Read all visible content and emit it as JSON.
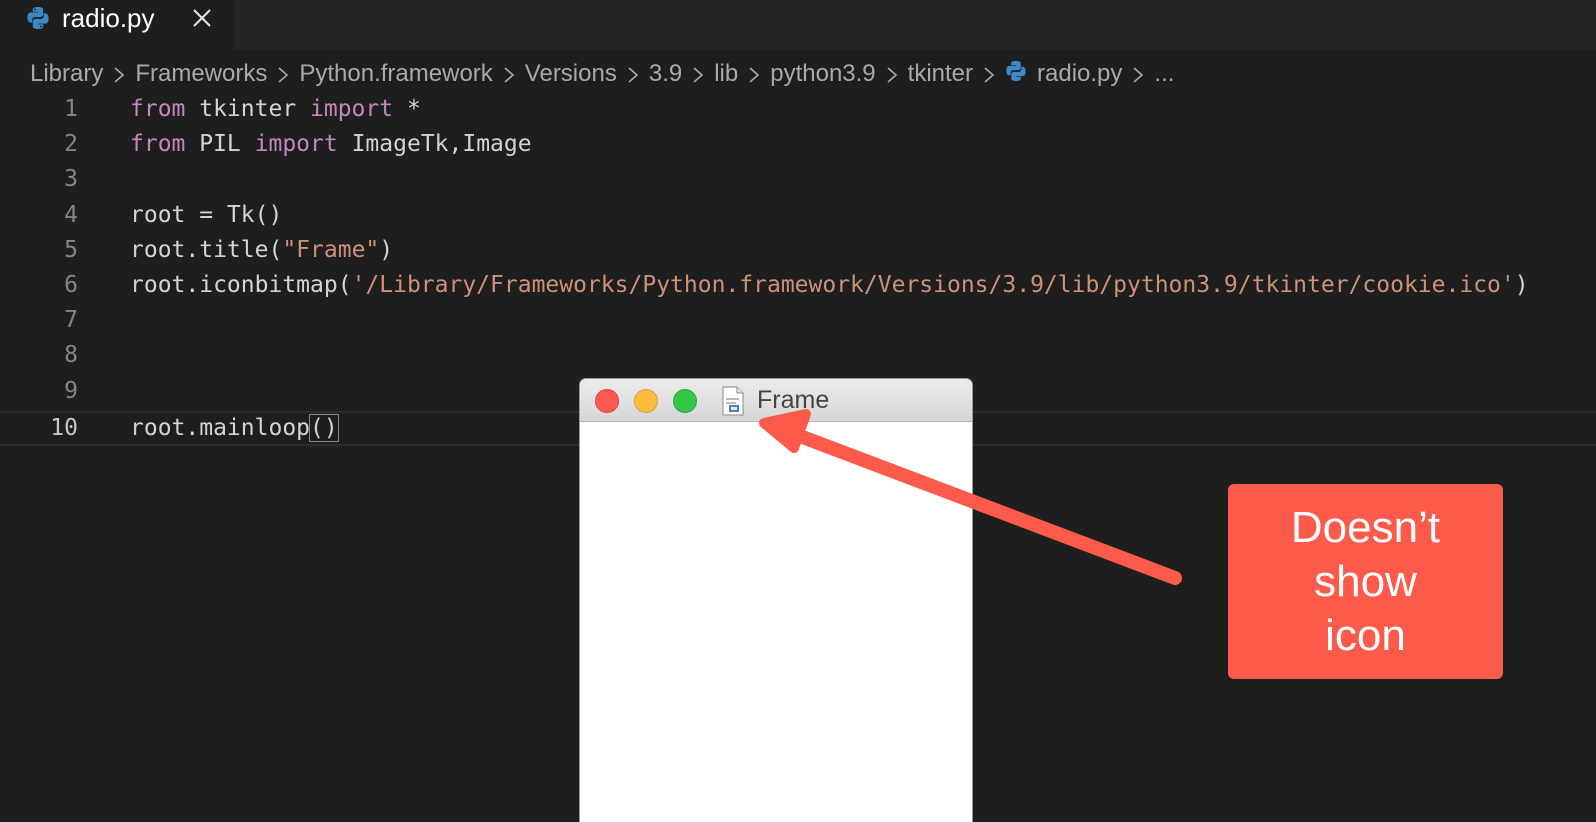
{
  "tab": {
    "label": "radio.py",
    "icon": "python-icon",
    "close_icon": "close-icon"
  },
  "breadcrumb": {
    "items": [
      "Library",
      "Frameworks",
      "Python.framework",
      "Versions",
      "3.9",
      "lib",
      "python3.9",
      "tkinter"
    ],
    "file": "radio.py",
    "ellipsis": "..."
  },
  "editor": {
    "line_numbers": [
      "1",
      "2",
      "3",
      "4",
      "5",
      "6",
      "7",
      "8",
      "9",
      "10"
    ],
    "active_line": 10,
    "lines": [
      [
        {
          "t": "from",
          "c": "kw"
        },
        {
          "t": " tkinter ",
          "c": ""
        },
        {
          "t": "import",
          "c": "kw"
        },
        {
          "t": " *",
          "c": ""
        }
      ],
      [
        {
          "t": "from",
          "c": "kw"
        },
        {
          "t": " PIL ",
          "c": ""
        },
        {
          "t": "import",
          "c": "kw"
        },
        {
          "t": " ImageTk,Image",
          "c": ""
        }
      ],
      [],
      [
        {
          "t": "root = Tk()",
          "c": ""
        }
      ],
      [
        {
          "t": "root.title(",
          "c": ""
        },
        {
          "t": "\"Frame\"",
          "c": "str"
        },
        {
          "t": ")",
          "c": ""
        }
      ],
      [
        {
          "t": "root.iconbitmap(",
          "c": ""
        },
        {
          "t": "'/Library/Frameworks/Python.framework/Versions/3.9/lib/python3.9/tkinter/cookie.ico'",
          "c": "str"
        },
        {
          "t": ")",
          "c": ""
        }
      ],
      [],
      [],
      [],
      [
        {
          "t": "root.mainloop",
          "c": ""
        },
        {
          "t": "()",
          "c": "bracket"
        }
      ]
    ]
  },
  "tk_window": {
    "title": "Frame",
    "icon": "generic-document-icon"
  },
  "annotation": {
    "text": "Doesn’t\nshow\nicon",
    "color": "#fc5a4b"
  },
  "colors": {
    "editor_bg": "#1e1e1e",
    "keyword": "#c586c0",
    "string": "#ce9178"
  }
}
